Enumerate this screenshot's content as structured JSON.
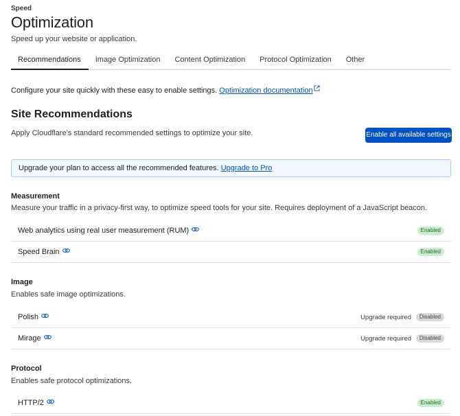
{
  "header": {
    "eyebrow": "Speed",
    "title": "Optimization",
    "subtitle": "Speed up your website or application."
  },
  "tabs": [
    {
      "label": "Recommendations",
      "active": true
    },
    {
      "label": "Image Optimization",
      "active": false
    },
    {
      "label": "Content Optimization",
      "active": false
    },
    {
      "label": "Protocol Optimization",
      "active": false
    },
    {
      "label": "Other",
      "active": false
    }
  ],
  "intro": {
    "text": "Configure your site quickly with these easy to enable settings.",
    "doc_link": "Optimization documentation"
  },
  "recommendations": {
    "title": "Site Recommendations",
    "description": "Apply Cloudflare's standard recommended settings to optimize your site.",
    "enable_button": "Enable all available settings"
  },
  "banner": {
    "text": "Upgrade your plan to access all the recommended features.",
    "link": "Upgrade to Pro"
  },
  "groups": {
    "measurement": {
      "title": "Measurement",
      "description": "Measure your traffic in a privacy-first way, to optimize speed tools for your site. Requires deployment of a JavaScript beacon.",
      "rows": [
        {
          "label": "Web analytics using real user measurement (RUM)",
          "upgrade": "",
          "status": "Enabled"
        },
        {
          "label": "Speed Brain",
          "upgrade": "",
          "status": "Enabled"
        }
      ]
    },
    "image": {
      "title": "Image",
      "description": "Enables safe image optimizations.",
      "rows": [
        {
          "label": "Polish",
          "upgrade": "Upgrade required",
          "status": "Disabled"
        },
        {
          "label": "Mirage",
          "upgrade": "Upgrade required",
          "status": "Disabled"
        }
      ]
    },
    "protocol": {
      "title": "Protocol",
      "description": "Enables safe protocol optimizations.",
      "rows": [
        {
          "label": "HTTP/2",
          "upgrade": "",
          "status": "Enabled"
        }
      ]
    }
  },
  "colors": {
    "accent": "#0051c3",
    "enabled_bg": "#c9eecf",
    "disabled_bg": "#d9d9d9"
  }
}
